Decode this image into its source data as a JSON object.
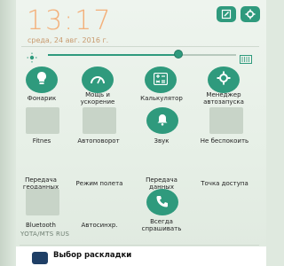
{
  "header": {
    "time": "13:17",
    "date": "среда, 24 авг. 2016 г."
  },
  "colors": {
    "accent": "#2f9a7d",
    "clock": "#f3b07a",
    "inactive_tile": "#c8d4c8"
  },
  "brightness": {
    "level_fraction": 0.62
  },
  "tiles": {
    "flashlight": {
      "label": "Фонарик",
      "icon": "lightbulb-icon"
    },
    "performance": {
      "label": "Мощь и\nускорение",
      "icon": "speedometer-icon"
    },
    "calculator": {
      "label": "Калькулятор",
      "icon": "calculator-icon"
    },
    "autostart": {
      "label": "Менеджер\nавтозапуска",
      "icon": "gear-icon"
    },
    "fitnes": {
      "label": "Fitnes"
    },
    "autorotate": {
      "label": "Автоповорот"
    },
    "sound": {
      "label": "Звук",
      "icon": "bell-icon"
    },
    "dnd": {
      "label": "Не беспокоить"
    },
    "location": {
      "label": "Передача\nгеоданных"
    },
    "airplane": {
      "label": "Режим полета"
    },
    "data": {
      "label": "Передача\nданных"
    },
    "hotspot": {
      "label": "Точка доступа"
    },
    "bluetooth": {
      "label": "Bluetooth"
    },
    "autosync": {
      "label": "Автосинхр."
    },
    "always_ask": {
      "label": "Всегда\nспрашивать",
      "icon": "phone-icon"
    }
  },
  "status": {
    "carrier": "YOTA/MTS RUS"
  },
  "notification": {
    "title": "Выбор раскладки"
  }
}
